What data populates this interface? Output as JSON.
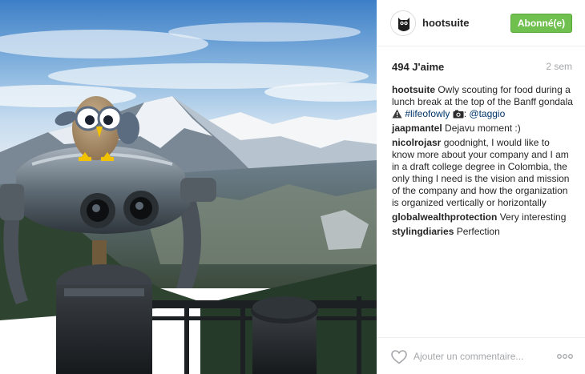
{
  "header": {
    "username": "hootsuite",
    "follow_label": "Abonné(e)"
  },
  "stats": {
    "likes": "494 J'aime",
    "age": "2 sem"
  },
  "caption": {
    "username": "hootsuite",
    "text": "Owly scouting for food during a lunch break at the top of the Banff gondala",
    "hashtag": "#lifeofowly",
    "mention": "@taggio",
    "icons": [
      "warning-icon",
      "camera-icon"
    ]
  },
  "comments": [
    {
      "username": "jaapmantel",
      "text": "Dejavu moment :)"
    },
    {
      "username": "nicolrojasr",
      "text": "goodnight, I would like to know more about your company and I am in a draft college degree in Colombia, the only thing I need is the vision and mission of the company and how the organization is organized vertically or horizontally"
    },
    {
      "username": "globalwealthprotection",
      "text": "Very interesting"
    },
    {
      "username": "stylingdiaries",
      "text": "Perfection"
    }
  ],
  "footer": {
    "comment_placeholder": "Ajouter un commentaire..."
  },
  "colors": {
    "follow_button": "#70c050",
    "link": "#003569",
    "muted_text": "#a5a7aa"
  }
}
